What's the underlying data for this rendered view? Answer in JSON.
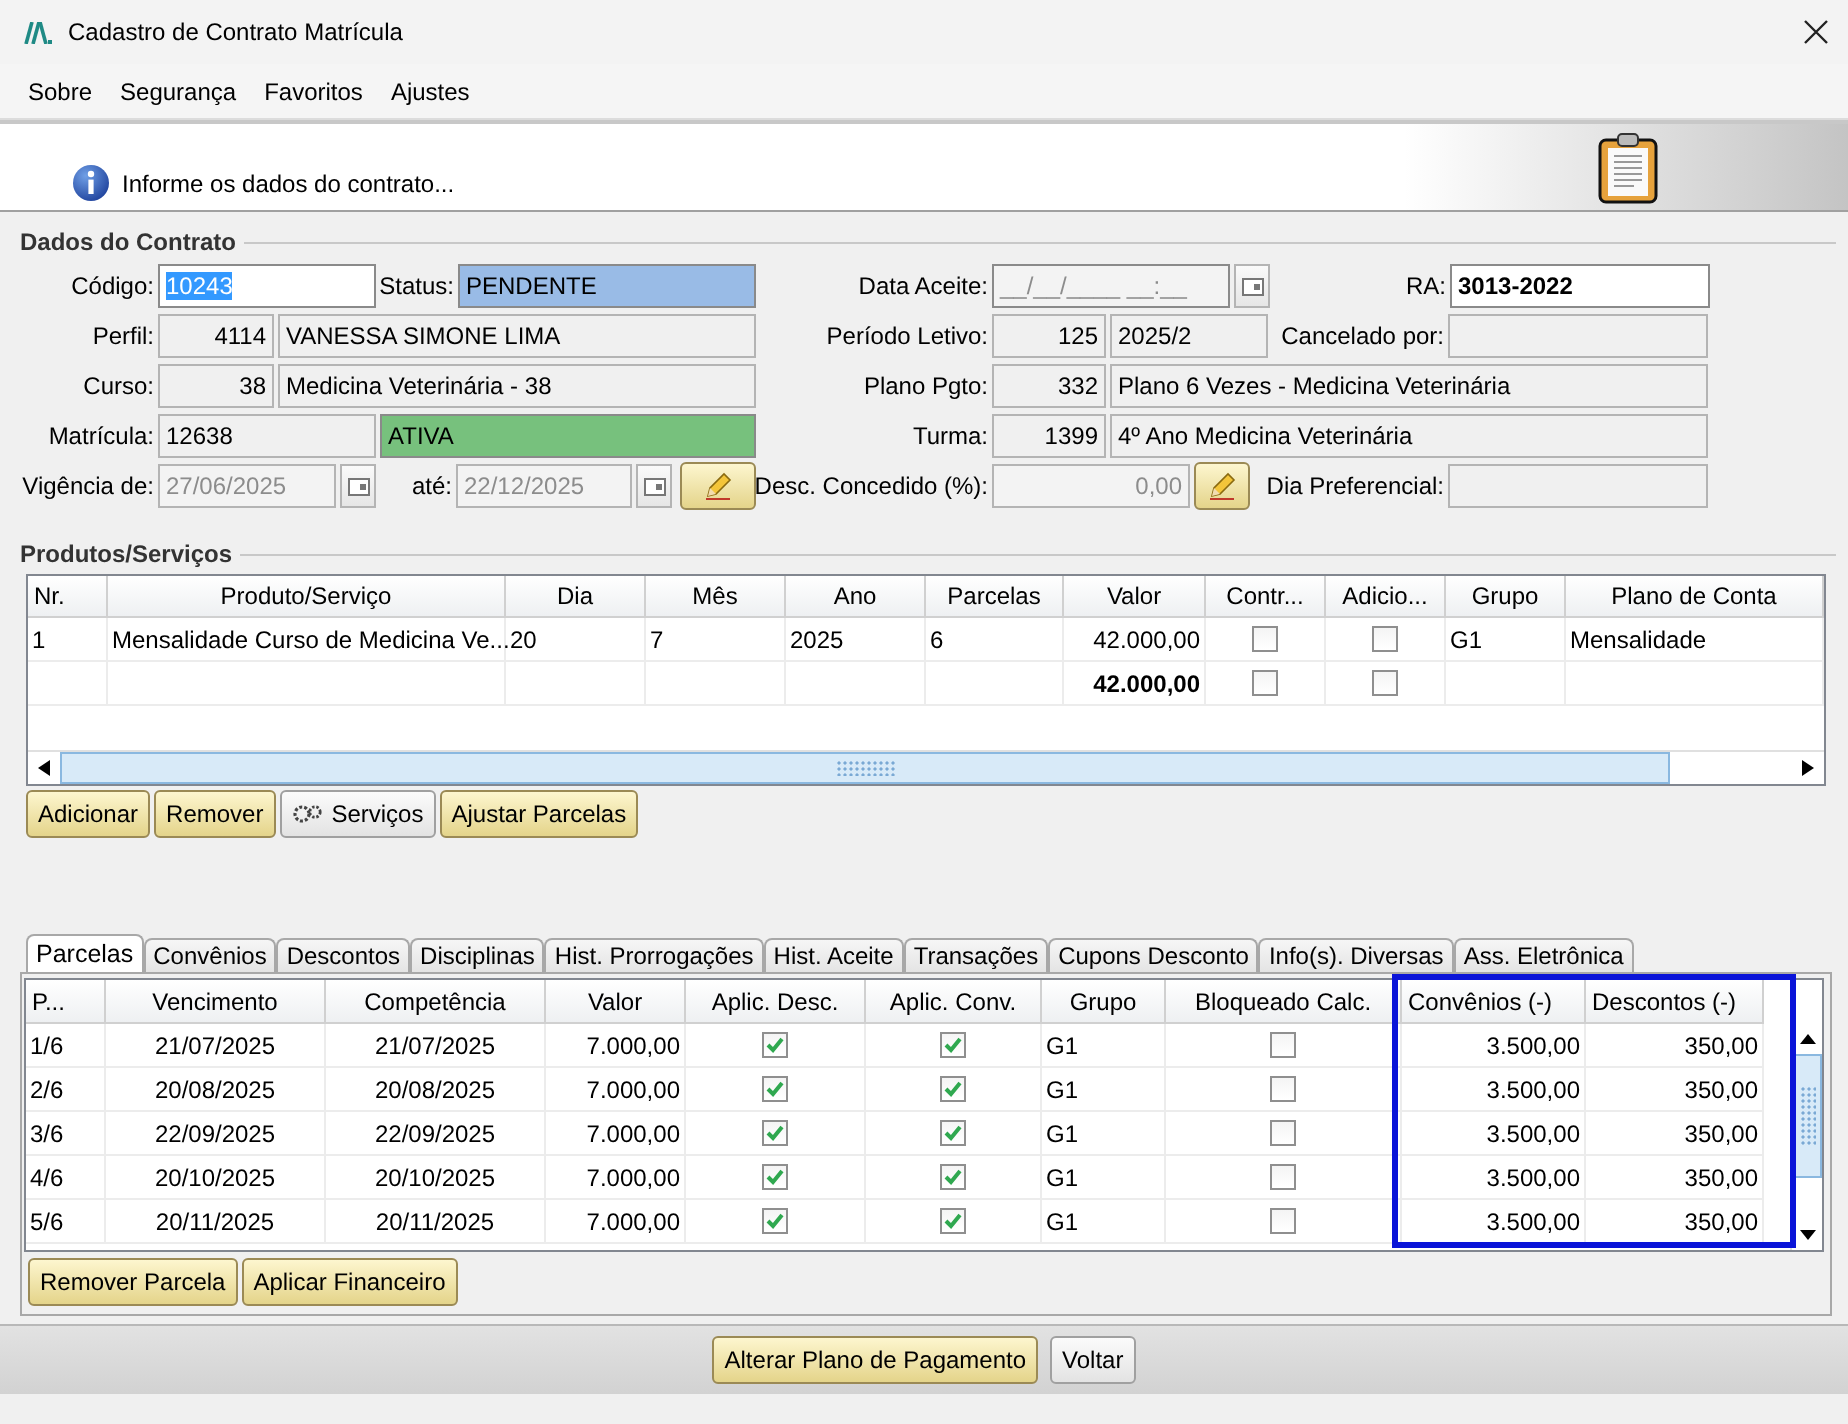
{
  "window": {
    "title": "Cadastro de Contrato Matrícula"
  },
  "menu": [
    "Sobre",
    "Segurança",
    "Favoritos",
    "Ajustes"
  ],
  "header": {
    "message": "Informe os dados do contrato..."
  },
  "contract": {
    "title": "Dados do Contrato",
    "codigo": {
      "label": "Código:",
      "value": "10243",
      "selected": true
    },
    "status": {
      "label": "Status:",
      "value": "PENDENTE",
      "color": "#99bbe6"
    },
    "data_aceite": {
      "label": "Data Aceite:",
      "value": "__/__/____ __:__",
      "disabled": true
    },
    "ra": {
      "label": "RA:",
      "value": "3013-2022"
    },
    "perfil": {
      "label": "Perfil:",
      "code": "4114",
      "value": "VANESSA SIMONE LIMA"
    },
    "periodo_letivo": {
      "label": "Período Letivo:",
      "code": "125",
      "value": "2025/2"
    },
    "cancelado_por": {
      "label": "Cancelado por:"
    },
    "curso": {
      "label": "Curso:",
      "code": "38",
      "value": "Medicina Veterinária - 38"
    },
    "plano_pgto": {
      "label": "Plano Pgto:",
      "code": "332",
      "value": "Plano 6 Vezes - Medicina Veterinária"
    },
    "matricula": {
      "label": "Matrícula:",
      "value": "12638"
    },
    "situacao": {
      "value": "ATIVA",
      "color": "#77c17d"
    },
    "turma": {
      "label": "Turma:",
      "code": "1399",
      "value": "4º Ano Medicina Veterinária"
    },
    "vigencia_de": {
      "label": "Vigência de:",
      "value": "27/06/2025",
      "disabled": true
    },
    "vigencia_ate": {
      "label": "até:",
      "value": "22/12/2025",
      "disabled": true
    },
    "desc_concedido": {
      "label": "Desc. Concedido (%):",
      "value": "0,00",
      "disabled": true
    },
    "dia_preferencial": {
      "label": "Dia Preferencial:"
    }
  },
  "products": {
    "title": "Produtos/Serviços",
    "columns": [
      "Nr.",
      "Produto/Serviço",
      "Dia",
      "Mês",
      "Ano",
      "Parcelas",
      "Valor",
      "Contr...",
      "Adicio...",
      "Grupo",
      "Plano de Conta"
    ],
    "rows": [
      {
        "kind": "item",
        "nr": "1",
        "produto": "Mensalidade Curso de Medicina Ve...",
        "dia": "20",
        "mes": "7",
        "ano": "2025",
        "parcelas": "6",
        "valor": "42.000,00",
        "contr": false,
        "adicio": false,
        "grupo": "G1",
        "plano_conta": "Mensalidade"
      },
      {
        "kind": "total",
        "valor": "42.000,00",
        "contr": false,
        "adicio": false
      }
    ]
  },
  "product_buttons": [
    {
      "label": "Adicionar",
      "kind": "action"
    },
    {
      "label": "Remover",
      "kind": "action"
    },
    {
      "label": "Serviços",
      "kind": "tool"
    },
    {
      "label": "Ajustar Parcelas",
      "kind": "action"
    }
  ],
  "tabs": [
    {
      "label": "Parcelas",
      "selected": true
    },
    {
      "label": "Convênios",
      "selected": false
    },
    {
      "label": "Descontos",
      "selected": false
    },
    {
      "label": "Disciplinas",
      "selected": false
    },
    {
      "label": "Hist. Prorrogações",
      "selected": false
    },
    {
      "label": "Hist. Aceite",
      "selected": false
    },
    {
      "label": "Transações",
      "selected": false
    },
    {
      "label": "Cupons Desconto",
      "selected": false
    },
    {
      "label": "Info(s). Diversas",
      "selected": false
    },
    {
      "label": "Ass. Eletrônica",
      "selected": false
    }
  ],
  "installments": {
    "highlight_frame": true,
    "columns": [
      "P...",
      "Vencimento",
      "Competência",
      "Valor",
      "Aplic. Desc.",
      "Aplic. Conv.",
      "Grupo",
      "Bloqueado Calc.",
      "Convênios (-)",
      "Descontos (-)"
    ],
    "rows": [
      {
        "p": "1/6",
        "vencimento": "21/07/2025",
        "competencia": "21/07/2025",
        "valor": "7.000,00",
        "aplic_desc": true,
        "aplic_conv": true,
        "grupo": "G1",
        "bloqueado": false,
        "convenios": "3.500,00",
        "descontos": "350,00"
      },
      {
        "p": "2/6",
        "vencimento": "20/08/2025",
        "competencia": "20/08/2025",
        "valor": "7.000,00",
        "aplic_desc": true,
        "aplic_conv": true,
        "grupo": "G1",
        "bloqueado": false,
        "convenios": "3.500,00",
        "descontos": "350,00"
      },
      {
        "p": "3/6",
        "vencimento": "22/09/2025",
        "competencia": "22/09/2025",
        "valor": "7.000,00",
        "aplic_desc": true,
        "aplic_conv": true,
        "grupo": "G1",
        "bloqueado": false,
        "convenios": "3.500,00",
        "descontos": "350,00"
      },
      {
        "p": "4/6",
        "vencimento": "20/10/2025",
        "competencia": "20/10/2025",
        "valor": "7.000,00",
        "aplic_desc": true,
        "aplic_conv": true,
        "grupo": "G1",
        "bloqueado": false,
        "convenios": "3.500,00",
        "descontos": "350,00"
      },
      {
        "p": "5/6",
        "vencimento": "20/11/2025",
        "competencia": "20/11/2025",
        "valor": "7.000,00",
        "aplic_desc": true,
        "aplic_conv": true,
        "grupo": "G1",
        "bloqueado": false,
        "convenios": "3.500,00",
        "descontos": "350,00"
      }
    ]
  },
  "installment_buttons": [
    {
      "label": "Remover Parcela",
      "kind": "action"
    },
    {
      "label": "Aplicar Financeiro",
      "kind": "action"
    }
  ],
  "footer_buttons": [
    {
      "label": "Alterar Plano de Pagamento",
      "kind": "action"
    },
    {
      "label": "Voltar",
      "kind": "plain"
    }
  ]
}
